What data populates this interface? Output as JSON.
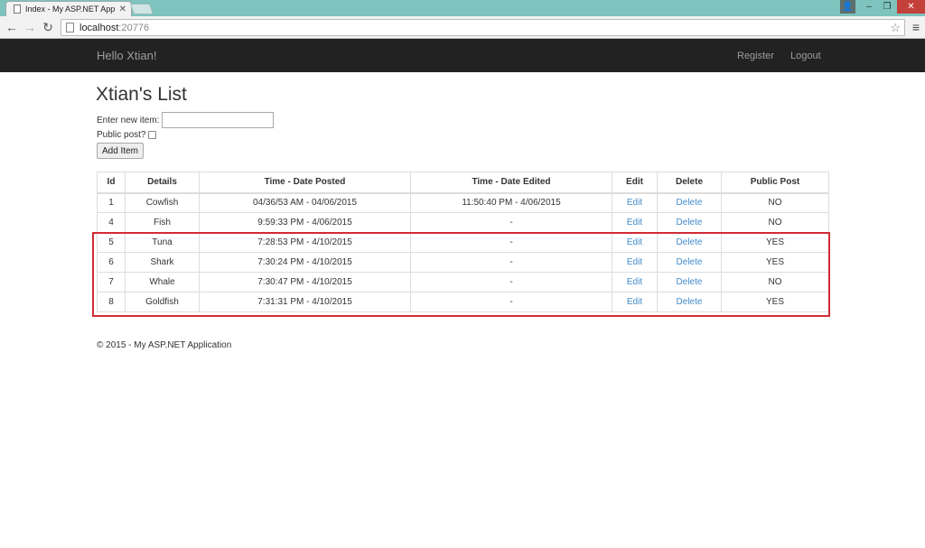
{
  "browser": {
    "tab_title": "Index - My ASP.NET Appli",
    "url_host": "localhost",
    "url_port": ":20776"
  },
  "navbar": {
    "brand": "Hello Xtian!",
    "links": [
      "Register",
      "Logout"
    ]
  },
  "page": {
    "title": "Xtian's List",
    "new_item_label": "Enter new item:",
    "new_item_value": "",
    "public_label": "Public post?",
    "public_checked": false,
    "add_button": "Add Item"
  },
  "table": {
    "headers": [
      "Id",
      "Details",
      "Time - Date Posted",
      "Time - Date Edited",
      "Edit",
      "Delete",
      "Public Post"
    ],
    "rows": [
      {
        "id": "1",
        "details": "Cowfish",
        "posted": "04/36/53 AM - 04/06/2015",
        "edited": "11:50:40 PM - 4/06/2015",
        "edit": "Edit",
        "delete": "Delete",
        "public": "NO"
      },
      {
        "id": "4",
        "details": "Fish",
        "posted": "9:59:33 PM - 4/06/2015",
        "edited": "-",
        "edit": "Edit",
        "delete": "Delete",
        "public": "NO"
      },
      {
        "id": "5",
        "details": "Tuna",
        "posted": "7:28:53 PM - 4/10/2015",
        "edited": "-",
        "edit": "Edit",
        "delete": "Delete",
        "public": "YES"
      },
      {
        "id": "6",
        "details": "Shark",
        "posted": "7:30:24 PM - 4/10/2015",
        "edited": "-",
        "edit": "Edit",
        "delete": "Delete",
        "public": "YES"
      },
      {
        "id": "7",
        "details": "Whale",
        "posted": "7:30:47 PM - 4/10/2015",
        "edited": "-",
        "edit": "Edit",
        "delete": "Delete",
        "public": "NO"
      },
      {
        "id": "8",
        "details": "Goldfish",
        "posted": "7:31:31 PM - 4/10/2015",
        "edited": "-",
        "edit": "Edit",
        "delete": "Delete",
        "public": "YES"
      }
    ]
  },
  "footer": "© 2015 - My ASP.NET Application",
  "colors": {
    "navbar_bg": "#222222",
    "link": "#428bca",
    "highlight": "#d02b36",
    "chrome": "#7ec3bd"
  }
}
